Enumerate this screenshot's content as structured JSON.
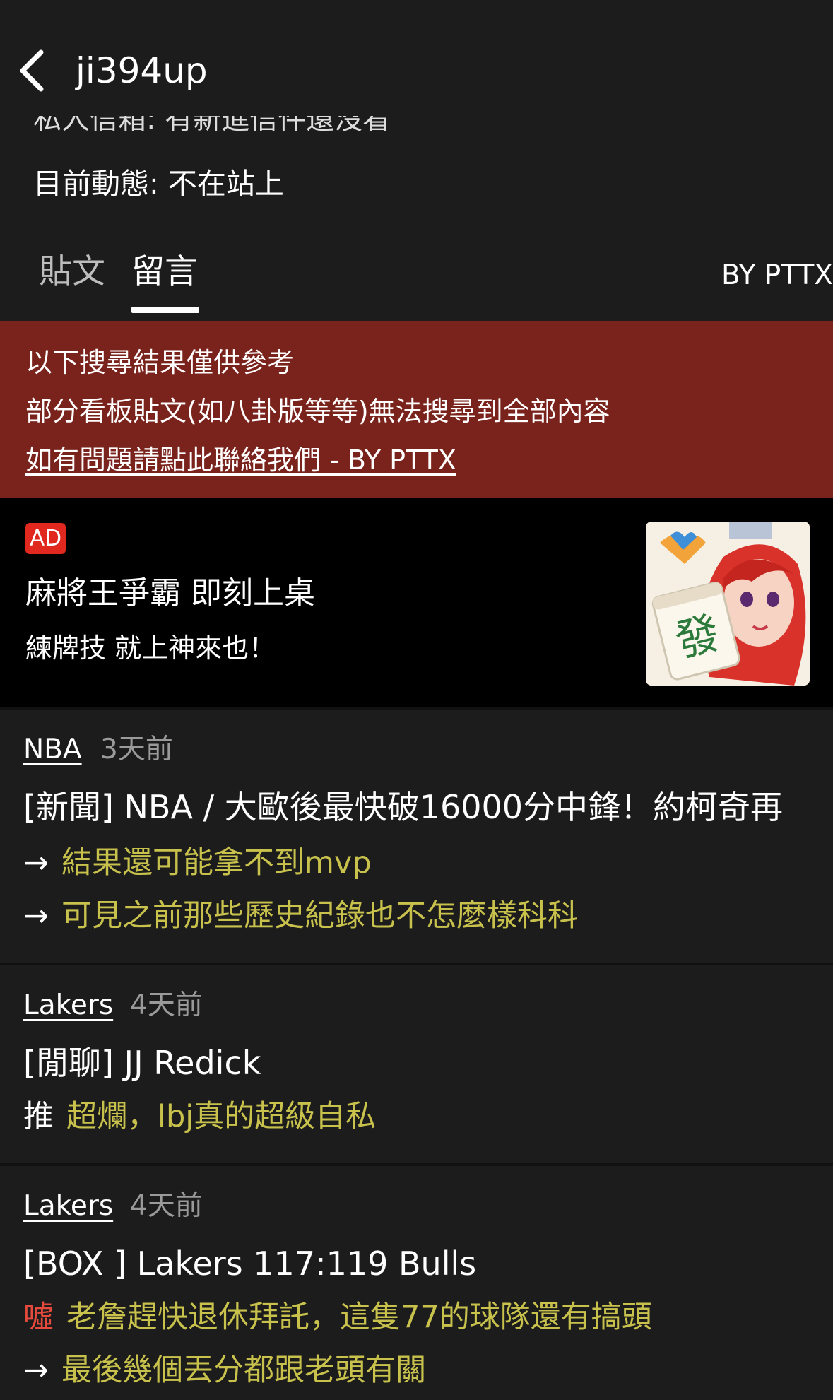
{
  "header": {
    "title": "ji394up"
  },
  "profile": {
    "clipped_line": "私人信箱: 有新進信件還沒看",
    "status": "目前動態: 不在站上"
  },
  "tabs": [
    {
      "label": "貼文",
      "active": false
    },
    {
      "label": "留言",
      "active": true
    }
  ],
  "by_pttx": "BY PTTX",
  "notice": {
    "line1": "以下搜尋結果僅供參考",
    "line2": "部分看板貼文(如八卦版等等)無法搜尋到全部內容",
    "link": "如有問題請點此聯絡我們 - BY PTTX",
    "bg_color": "#7a231c"
  },
  "ad": {
    "badge": "AD",
    "title": "麻將王爭霸 即刻上桌",
    "subtitle": "練牌技 就上神來也！",
    "image_icon": "mahjong-game-icon"
  },
  "items": [
    {
      "board": "NBA",
      "time": "3天前",
      "title": "[新聞] NBA / 大歐後最快破16000分中鋒！約柯奇再",
      "comments": [
        {
          "prefix": "→",
          "text": "結果還可能拿不到mvp"
        },
        {
          "prefix": "→",
          "text": "可見之前那些歷史紀錄也不怎麼樣科科"
        }
      ]
    },
    {
      "board": "Lakers",
      "time": "4天前",
      "title": "[閒聊] JJ Redick",
      "comments": [
        {
          "prefix": "推",
          "text": "超爛，lbj真的超級自私"
        }
      ]
    },
    {
      "board": "Lakers",
      "time": "4天前",
      "title": "[BOX ] Lakers 117:119 Bulls",
      "comments": [
        {
          "prefix": "噓",
          "text": "老詹趕快退休拜託，這隻77的球隊還有搞頭"
        },
        {
          "prefix": "→",
          "text": "最後幾個丟分都跟老頭有關"
        }
      ]
    }
  ],
  "colors": {
    "comment": "#c8c24d",
    "boo": "#e54a3c",
    "background": "#1c1c1c"
  }
}
